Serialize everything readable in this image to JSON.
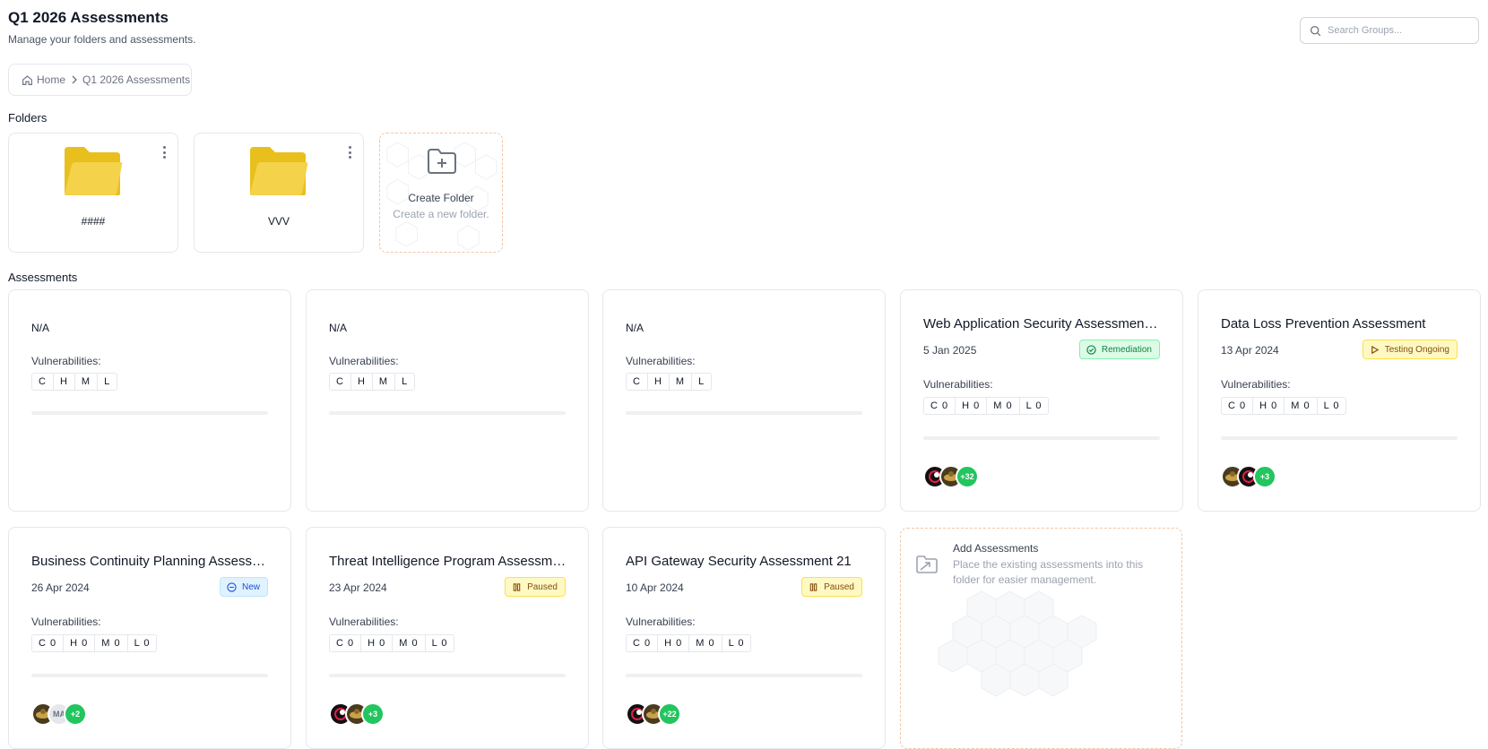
{
  "header": {
    "title": "Q1 2026 Assessments",
    "subtitle": "Manage your folders and assessments."
  },
  "search": {
    "placeholder": "Search Groups...",
    "value": ""
  },
  "breadcrumb": {
    "items": [
      "Home",
      "Q1 2026 Assessments"
    ]
  },
  "sections": {
    "folders": "Folders",
    "assessments": "Assessments"
  },
  "folders": [
    {
      "name": "####"
    },
    {
      "name": "VVV"
    }
  ],
  "create_folder": {
    "title": "Create Folder",
    "subtitle": "Create a new folder."
  },
  "vuln_label": "Vulnerabilities:",
  "assessments": [
    {
      "title": "N/A",
      "vulns": [
        "C",
        "H",
        "M",
        "L"
      ],
      "progress": 0
    },
    {
      "title": "N/A",
      "vulns": [
        "C",
        "H",
        "M",
        "L"
      ],
      "progress": 0
    },
    {
      "title": "N/A",
      "vulns": [
        "C",
        "H",
        "M",
        "L"
      ],
      "progress": 0
    },
    {
      "title": "Web Application Security Assessment ...",
      "date": "5 Jan 2025",
      "status": "Remediation",
      "vulns": [
        "C 0",
        "H 0",
        "M 0",
        "L 0"
      ],
      "progress": 0,
      "avatar_more": "+32"
    },
    {
      "title": "Data Loss Prevention Assessment",
      "date": "13 Apr 2024",
      "status": "Testing Ongoing",
      "vulns": [
        "C 0",
        "H 0",
        "M 0",
        "L 0"
      ],
      "progress": 0,
      "avatar_more": "+3"
    },
    {
      "title": "Business Continuity Planning Assessm...",
      "date": "26 Apr 2024",
      "status": "New",
      "vulns": [
        "C 0",
        "H 0",
        "M 0",
        "L 0"
      ],
      "progress": 0,
      "avatar_initials": "MA",
      "avatar_more": "+2"
    },
    {
      "title": "Threat Intelligence Program Assessme...",
      "date": "23 Apr 2024",
      "status": "Paused",
      "vulns": [
        "C 0",
        "H 0",
        "M 0",
        "L 0"
      ],
      "progress": 0,
      "avatar_more": "+3"
    },
    {
      "title": "API Gateway Security Assessment 21",
      "date": "10 Apr 2024",
      "status": "Paused",
      "vulns": [
        "C 0",
        "H 0",
        "M 0",
        "L 0"
      ],
      "progress": 0,
      "avatar_more": "+22"
    }
  ],
  "add_assessments": {
    "title": "Add Assessments",
    "subtitle": "Place the existing assessments into this folder for easier management."
  },
  "colors": {
    "accent_green": "#22c55e",
    "folder_yellow": "#f2cd2f",
    "dashed_border": "#f4c4a4"
  }
}
